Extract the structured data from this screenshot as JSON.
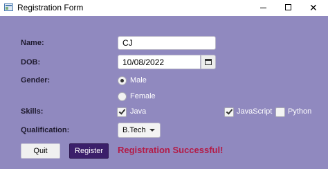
{
  "window": {
    "title": "Registration Form"
  },
  "form": {
    "name_label": "Name:",
    "name_value": "CJ",
    "dob_label": "DOB:",
    "dob_value": "10/08/2022",
    "gender_label": "Gender:",
    "gender_options": [
      "Male",
      "Female"
    ],
    "gender_selected": "Male",
    "skills_label": "Skills:",
    "skills": [
      {
        "label": "Java",
        "checked": true
      },
      {
        "label": "JavaScript",
        "checked": true
      },
      {
        "label": "Python",
        "checked": false
      }
    ],
    "qualification_label": "Qualification:",
    "qualification_value": "B.Tech"
  },
  "actions": {
    "quit_label": "Quit",
    "register_label": "Register"
  },
  "status": {
    "message": "Registration Successful!",
    "color": "#b31b47"
  },
  "colors": {
    "background": "#9089bf",
    "register_button": "#3b1f6a"
  }
}
